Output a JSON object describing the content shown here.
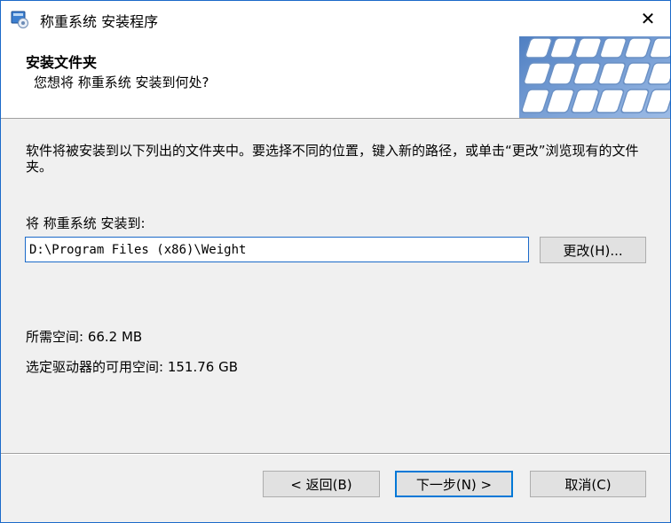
{
  "window": {
    "title": "称重系统 安装程序",
    "close_symbol": "✕",
    "accent_color": "#0078d7"
  },
  "icons": {
    "app": "installer-icon",
    "close": "close-icon",
    "banner": "keyboard-banner"
  },
  "header": {
    "title": "安装文件夹",
    "subtitle": "您想将 称重系统 安装到何处?"
  },
  "body": {
    "instructions": "软件将被安装到以下列出的文件夹中。要选择不同的位置，键入新的路径，或单击“更改”浏览现有的文件夹。",
    "install_to_label": "将 称重系统 安装到:",
    "install_path": "D:\\Program Files (x86)\\Weight",
    "change_button": "更改(H)...",
    "space_required": "所需空间: 66.2 MB",
    "space_available": "选定驱动器的可用空间: 151.76 GB"
  },
  "footer": {
    "back_button": "< 返回(B)",
    "next_button": "下一步(N) >",
    "cancel_button": "取消(C)"
  }
}
